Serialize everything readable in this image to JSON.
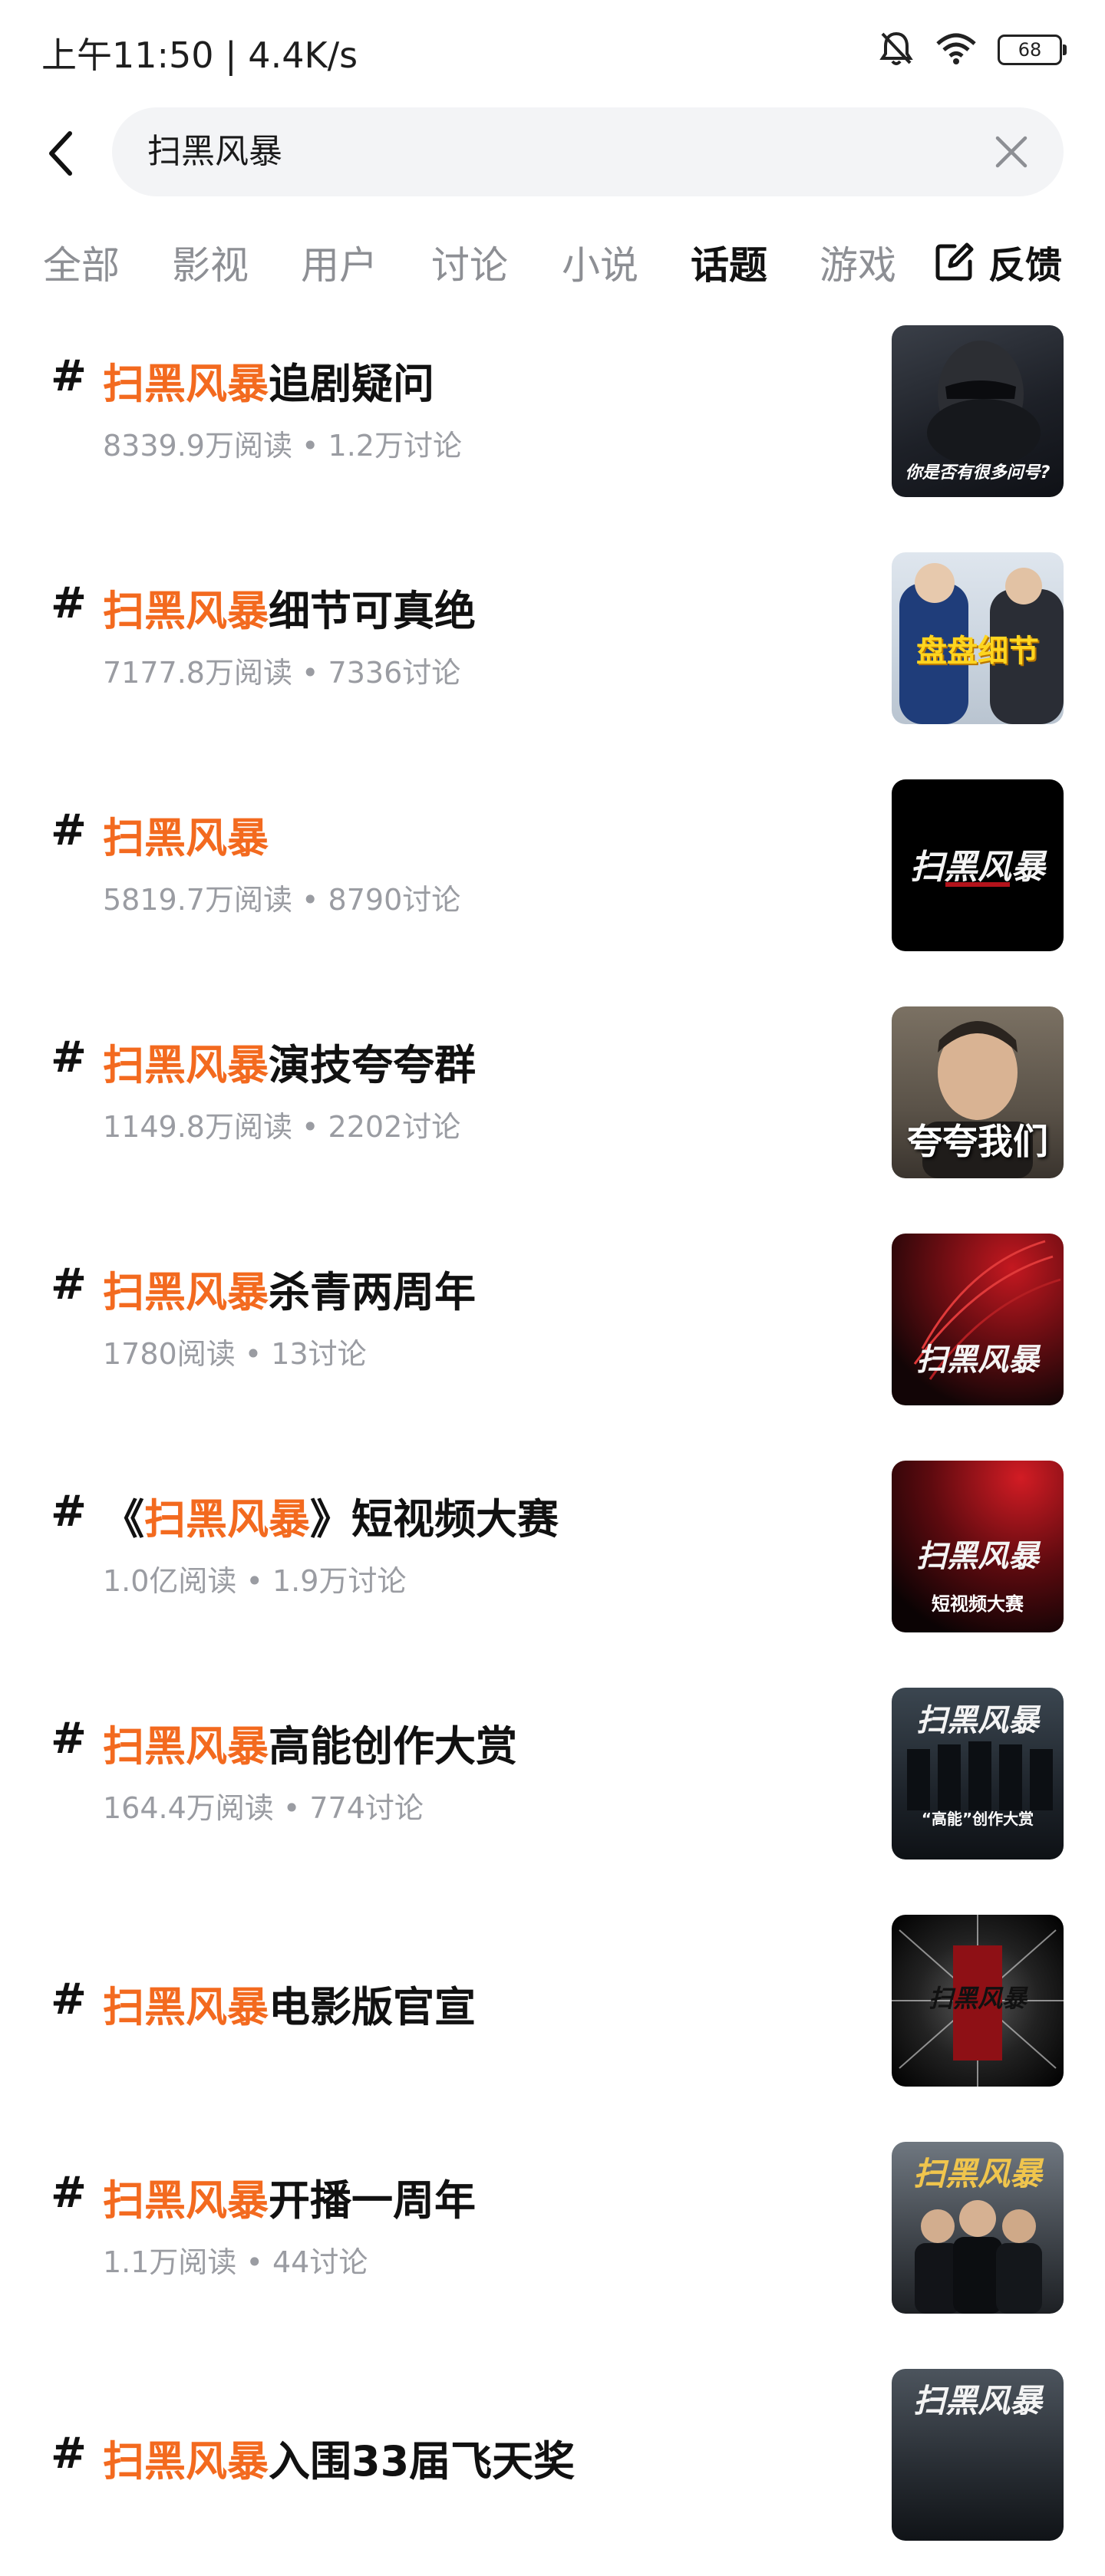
{
  "status": {
    "time": "上午11:50 | 4.4K/s",
    "battery": "68"
  },
  "search": {
    "query": "扫黑风暴"
  },
  "tabs": [
    "全部",
    "影视",
    "用户",
    "讨论",
    "小说",
    "话题",
    "游戏"
  ],
  "active_tab": "话题",
  "feedback_label": "反馈",
  "topics": [
    {
      "prefix": "",
      "highlight": "扫黑风暴",
      "rest": "追剧疑问",
      "meta": "8339.9万阅读 • 1.2万讨论",
      "thumb_text": "你是否有很多问号?"
    },
    {
      "prefix": "",
      "highlight": "扫黑风暴",
      "rest": "细节可真绝",
      "meta": "7177.8万阅读 • 7336讨论",
      "thumb_text": "盘盘细节"
    },
    {
      "prefix": "",
      "highlight": "扫黑风暴",
      "rest": "",
      "meta": "5819.7万阅读 • 8790讨论",
      "thumb_text": "扫黑风暴"
    },
    {
      "prefix": "",
      "highlight": "扫黑风暴",
      "rest": "演技夸夸群",
      "meta": "1149.8万阅读 • 2202讨论",
      "thumb_text": "夸夸我们"
    },
    {
      "prefix": "",
      "highlight": "扫黑风暴",
      "rest": "杀青两周年",
      "meta": "1780阅读 • 13讨论",
      "thumb_text": "扫黑风暴"
    },
    {
      "prefix": "《",
      "highlight": "扫黑风暴",
      "rest": "》短视频大赛",
      "meta": "1.0亿阅读 • 1.9万讨论",
      "thumb_text": "扫黑风暴",
      "thumb_sub": "短视频大赛"
    },
    {
      "prefix": "",
      "highlight": "扫黑风暴",
      "rest": "高能创作大赏",
      "meta": "164.4万阅读 • 774讨论",
      "thumb_text": "扫黑风暴",
      "thumb_sub": "“高能”创作大赏"
    },
    {
      "prefix": "",
      "highlight": "扫黑风暴",
      "rest": "电影版官宣",
      "meta": "",
      "thumb_text": "扫黑风暴"
    },
    {
      "prefix": "",
      "highlight": "扫黑风暴",
      "rest": "开播一周年",
      "meta": "1.1万阅读 • 44讨论",
      "thumb_text": "扫黑风暴"
    },
    {
      "prefix": "",
      "highlight": "扫黑风暴",
      "rest": "入围33届飞天奖",
      "meta": "",
      "thumb_text": "扫黑风暴"
    }
  ],
  "colors": {
    "highlight": "#f36a1f",
    "tab_inactive": "#8d8f94",
    "meta": "#9a9ca2",
    "search_bg": "#f3f4f6"
  }
}
